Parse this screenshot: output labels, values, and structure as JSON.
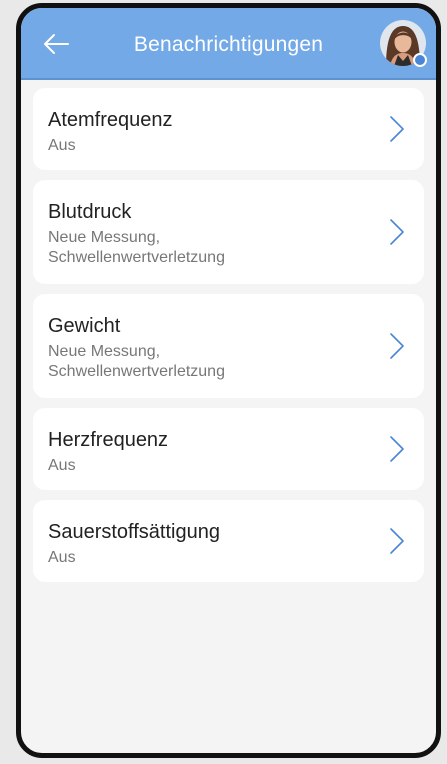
{
  "header": {
    "title": "Benachrichtigungen",
    "back_icon": "arrow-left-icon",
    "avatar_icon": "user-avatar"
  },
  "notifications": [
    {
      "title": "Atemfrequenz",
      "subtitle": "Aus"
    },
    {
      "title": "Blutdruck",
      "subtitle": "Neue Messung, Schwellenwertverletzung"
    },
    {
      "title": "Gewicht",
      "subtitle": "Neue Messung, Schwellenwertverletzung"
    },
    {
      "title": "Herzfrequenz",
      "subtitle": "Aus"
    },
    {
      "title": "Sauerstoffsättigung",
      "subtitle": "Aus"
    }
  ],
  "colors": {
    "header_bg": "#73a9e6",
    "page_bg": "#f4f4f4",
    "card_bg": "#ffffff",
    "chevron": "#4a86d4"
  }
}
